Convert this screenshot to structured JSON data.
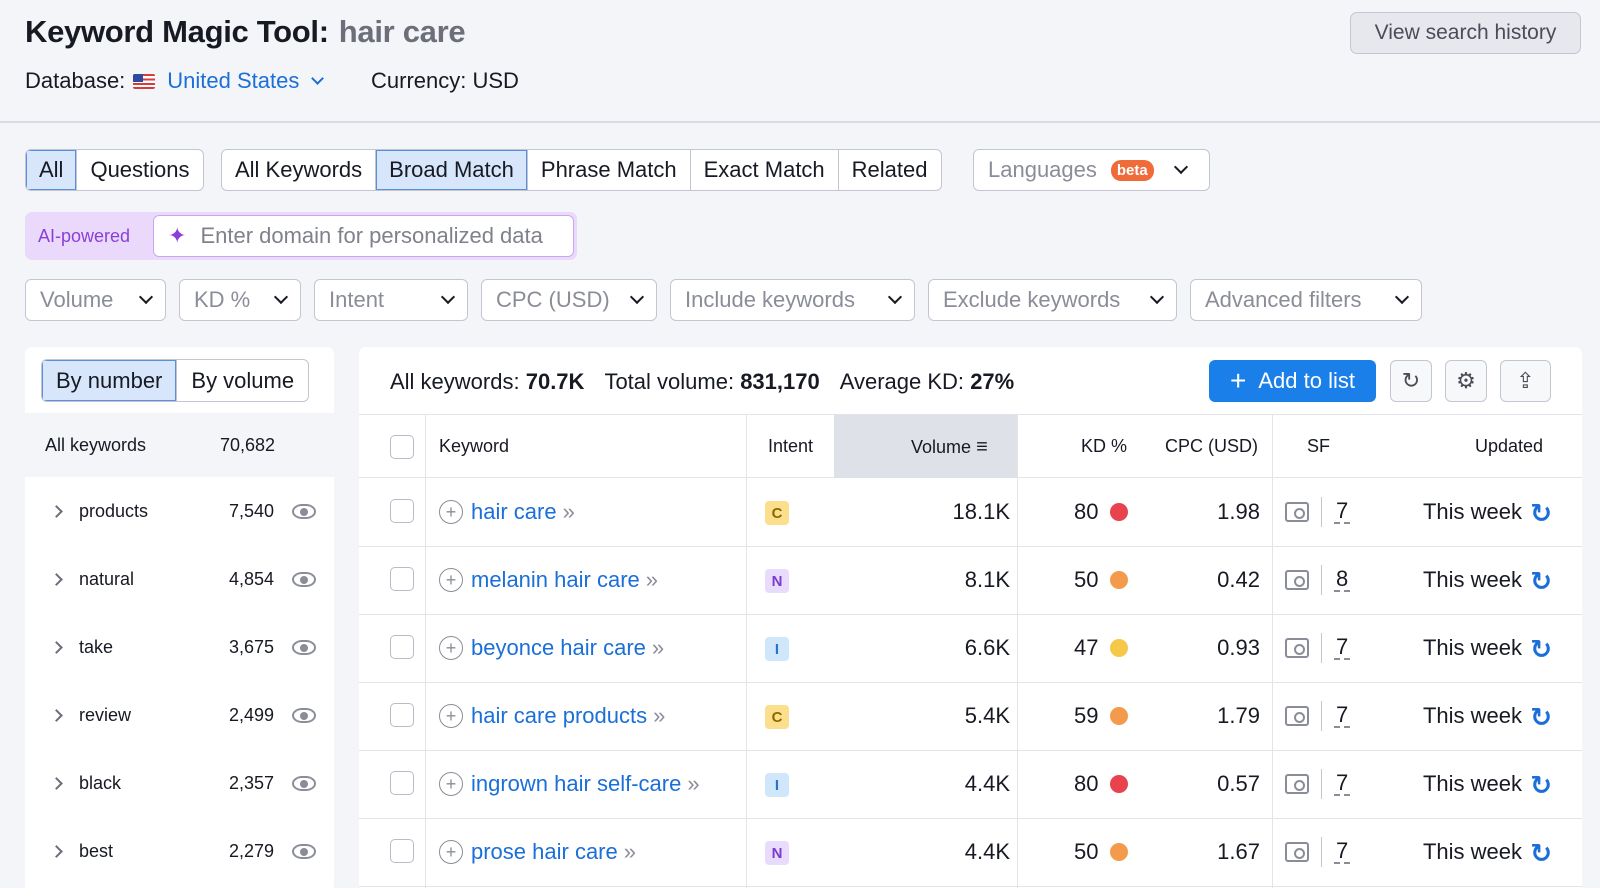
{
  "header": {
    "title": "Keyword Magic Tool:",
    "keyword": "hair care",
    "database_label": "Database:",
    "database_value": "United States",
    "currency": "Currency: USD",
    "history_button": "View search history"
  },
  "match_tabs_1": [
    "All",
    "Questions"
  ],
  "match_tabs_2": [
    "All Keywords",
    "Broad Match",
    "Phrase Match",
    "Exact Match",
    "Related"
  ],
  "languages": {
    "label": "Languages",
    "badge": "beta"
  },
  "ai": {
    "label": "AI-powered",
    "placeholder": "Enter domain for personalized data"
  },
  "filters": [
    "Volume",
    "KD %",
    "Intent",
    "CPC (USD)",
    "Include keywords",
    "Exclude keywords",
    "Advanced filters"
  ],
  "left_panel": {
    "tabs": [
      "By number",
      "By volume"
    ],
    "all_label": "All keywords",
    "all_count": "70,682",
    "groups": [
      {
        "name": "products",
        "count": "7,540"
      },
      {
        "name": "natural",
        "count": "4,854"
      },
      {
        "name": "take",
        "count": "3,675"
      },
      {
        "name": "review",
        "count": "2,499"
      },
      {
        "name": "black",
        "count": "2,357"
      },
      {
        "name": "best",
        "count": "2,279"
      }
    ]
  },
  "summary": {
    "all_label": "All keywords:",
    "all_value": "70.7K",
    "vol_label": "Total volume:",
    "vol_value": "831,170",
    "kd_label": "Average KD:",
    "kd_value": "27%"
  },
  "add_button": "Add to list",
  "columns": [
    "Keyword",
    "Intent",
    "Volume",
    "KD %",
    "CPC (USD)",
    "SF",
    "Updated"
  ],
  "rows": [
    {
      "keyword": "hair care",
      "intent": "C",
      "volume": "18.1K",
      "kd": "80",
      "kd_color": "#e8424d",
      "cpc": "1.98",
      "sf": "7",
      "updated": "This week"
    },
    {
      "keyword": "melanin hair care",
      "intent": "N",
      "volume": "8.1K",
      "kd": "50",
      "kd_color": "#f39a4d",
      "cpc": "0.42",
      "sf": "8",
      "updated": "This week"
    },
    {
      "keyword": "beyonce hair care",
      "intent": "I",
      "volume": "6.6K",
      "kd": "47",
      "kd_color": "#f5c84a",
      "cpc": "0.93",
      "sf": "7",
      "updated": "This week"
    },
    {
      "keyword": "hair care products",
      "intent": "C",
      "volume": "5.4K",
      "kd": "59",
      "kd_color": "#f39a4d",
      "cpc": "1.79",
      "sf": "7",
      "updated": "This week"
    },
    {
      "keyword": "ingrown hair self-care",
      "intent": "I",
      "volume": "4.4K",
      "kd": "80",
      "kd_color": "#e8424d",
      "cpc": "0.57",
      "sf": "7",
      "updated": "This week"
    },
    {
      "keyword": "prose hair care",
      "intent": "N",
      "volume": "4.4K",
      "kd": "50",
      "kd_color": "#f39a4d",
      "cpc": "1.67",
      "sf": "7",
      "updated": "This week"
    }
  ],
  "intent_colors": {
    "C": {
      "bg": "#fcdf8c",
      "fg": "#8a6a00"
    },
    "N": {
      "bg": "#e9dbfb",
      "fg": "#7a3bd0"
    },
    "I": {
      "bg": "#cfe6fb",
      "fg": "#2a72c6"
    }
  }
}
